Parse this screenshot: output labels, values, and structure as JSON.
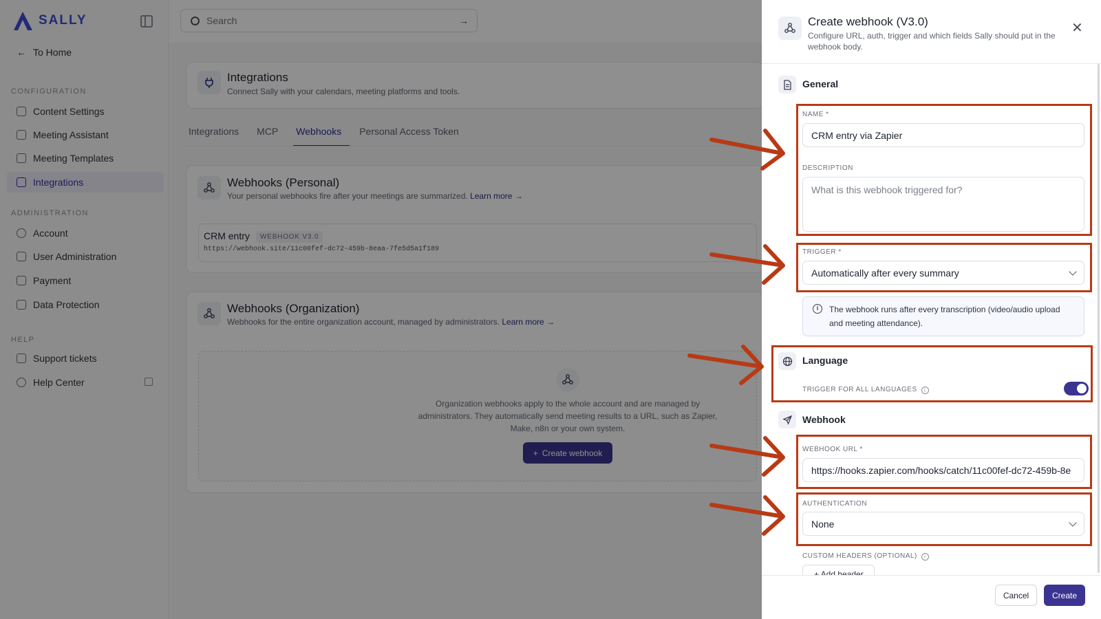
{
  "app": {
    "brand": "SALLY",
    "search_placeholder": "Search"
  },
  "sidebar": {
    "home": "To Home",
    "sections": [
      {
        "title": "CONFIGURATION",
        "items": [
          "Content Settings",
          "Meeting Assistant",
          "Meeting Templates",
          "Integrations"
        ]
      },
      {
        "title": "ADMINISTRATION",
        "items": [
          "Account",
          "User Administration",
          "Payment",
          "Data Protection"
        ]
      },
      {
        "title": "HELP",
        "items": [
          "Support tickets",
          "Help Center"
        ]
      }
    ],
    "active": "Integrations"
  },
  "page": {
    "title": "Integrations",
    "subtitle": "Connect Sally with your calendars, meeting platforms and tools.",
    "tabs": [
      "Integrations",
      "MCP",
      "Webhooks",
      "Personal Access Token"
    ],
    "active_tab": "Webhooks",
    "personal": {
      "title": "Webhooks (Personal)",
      "subtitle": "Your personal webhooks fire after your meetings are summarized.",
      "learn_more": "Learn more →",
      "entry_name": "CRM entry",
      "entry_badge": "WEBHOOK V3.0",
      "entry_url": "https://webhook.site/11c00fef-dc72-459b-8eaa-7fe5d5a1f189"
    },
    "organization": {
      "title": "Webhooks (Organization)",
      "subtitle": "Webhooks for the entire organization account, managed by administrators.",
      "learn_more": "Learn more →",
      "empty_text": "Organization webhooks apply to the whole account and are managed by administrators. They automatically send meeting results to a URL, such as Zapier, Make, n8n or your own system.",
      "create_button": "Create webhook"
    }
  },
  "drawer": {
    "title": "Create webhook (V3.0)",
    "subtitle": "Configure URL, auth, trigger and which fields Sally should put in the webhook body.",
    "sections": {
      "general": "General",
      "language": "Language",
      "webhook": "Webhook"
    },
    "name_label": "NAME *",
    "name_value": "CRM entry via Zapier",
    "description_label": "DESCRIPTION",
    "description_placeholder": "What is this webhook triggered for?",
    "trigger_label": "TRIGGER *",
    "trigger_value": "Automatically after every summary",
    "trigger_info": "The webhook runs after every transcription (video/audio upload and meeting attendance).",
    "language_toggle_label": "TRIGGER FOR ALL LANGUAGES",
    "language_toggle_on": true,
    "url_label": "WEBHOOK URL *",
    "url_value": "https://hooks.zapier.com/hooks/catch/11c00fef-dc72-459b-8e",
    "auth_label": "AUTHENTICATION",
    "auth_value": "None",
    "headers_label": "CUSTOM HEADERS (OPTIONAL)",
    "add_header": "+ Add header",
    "cancel": "Cancel",
    "create": "Create"
  },
  "colors": {
    "accent": "#3b3591",
    "annotation": "#b83a14"
  }
}
